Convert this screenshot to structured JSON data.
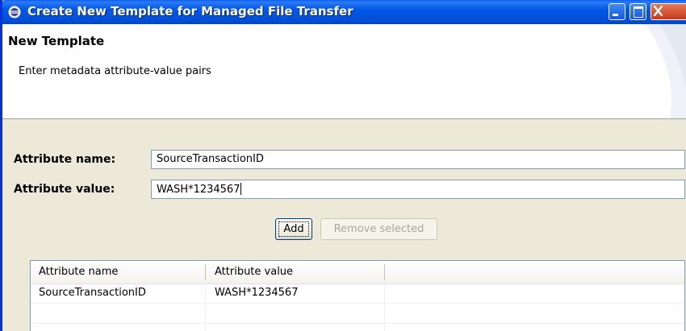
{
  "window": {
    "title": "Create New Template for Managed File Transfer",
    "icon": "eclipse-icon"
  },
  "banner": {
    "title": "New Template",
    "description": "Enter metadata attribute-value pairs"
  },
  "form": {
    "name_label": "Attribute name:",
    "name_value": "SourceTransactionID",
    "value_label": "Attribute value:",
    "value_value": "WASH*1234567"
  },
  "buttons": {
    "add_label": "Add",
    "remove_label": "Remove selected"
  },
  "table": {
    "headers": [
      "Attribute name",
      "Attribute value"
    ],
    "rows": [
      [
        "SourceTransactionID",
        "WASH*1234567"
      ]
    ]
  },
  "colors": {
    "titlebar": "#0054e3",
    "close": "#c6391a",
    "dialog_bg": "#ece9d8"
  }
}
